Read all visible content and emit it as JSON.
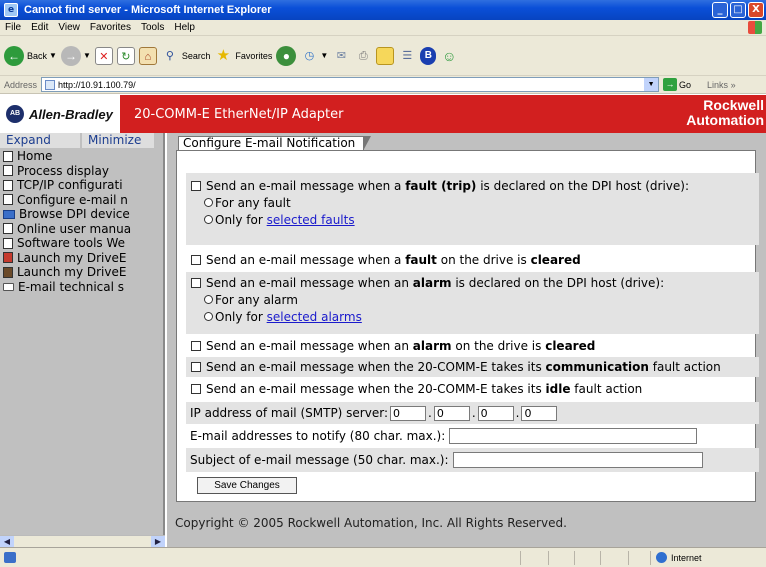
{
  "window": {
    "title": "Cannot find server - Microsoft Internet Explorer",
    "buttons": [
      "_",
      "□",
      "X"
    ]
  },
  "menu": [
    "File",
    "Edit",
    "View",
    "Favorites",
    "Tools",
    "Help"
  ],
  "toolbar": {
    "back": "Back",
    "search": "Search",
    "favorites": "Favorites"
  },
  "address": {
    "label": "Address",
    "url": "http://10.91.100.79/",
    "go": "Go",
    "links": "Links"
  },
  "brand": {
    "logo": "AB",
    "company": "Allen-Bradley",
    "product": "20-COMM-E EtherNet/IP Adapter",
    "rockwell_line1": "Rockwell",
    "rockwell_line2": "Automation"
  },
  "nav": {
    "expand": "Expand",
    "minimize": "Minimize",
    "items": [
      "Home",
      "Process display",
      "TCP/IP configurati",
      "Configure e-mail n",
      "Browse DPI device",
      "Online user manua",
      "Software tools We",
      "Launch my DriveE",
      "Launch my DriveE",
      "E-mail technical s"
    ]
  },
  "main": {
    "tab": "Configure E-mail Notification",
    "fault": {
      "pre": "Send an e-mail message when a ",
      "bold": "fault (trip)",
      "post": " is declared on the DPI host (drive):",
      "any": "For any fault",
      "only_pre": "Only for ",
      "only_link": "selected faults"
    },
    "fault_cleared": {
      "pre": "Send an e-mail message when a ",
      "bold1": "fault",
      "mid": " on the drive is ",
      "bold2": "cleared"
    },
    "alarm": {
      "pre": "Send an e-mail message when an ",
      "bold": "alarm",
      "post": " is declared on the DPI host (drive):",
      "any": "For any alarm",
      "only_pre": "Only for ",
      "only_link": "selected alarms"
    },
    "alarm_cleared": {
      "pre": "Send an e-mail message when an ",
      "bold1": "alarm",
      "mid": " on the drive is ",
      "bold2": "cleared"
    },
    "comm": {
      "pre": "Send an e-mail message when the 20-COMM-E takes its ",
      "bold": "communication",
      "post": " fault action"
    },
    "idle": {
      "pre": "Send an e-mail message when the 20-COMM-E takes its ",
      "bold": "idle",
      "post": " fault action"
    },
    "smtp": {
      "label": "IP address of mail (SMTP) server:",
      "octets": [
        "0",
        "0",
        "0",
        "0"
      ],
      "sep": "."
    },
    "addresses": {
      "label": "E-mail addresses to notify (80 char. max.):",
      "value": ""
    },
    "subject": {
      "label": "Subject of e-mail message (50 char. max.):",
      "value": ""
    },
    "save": "Save Changes",
    "copyright": "Copyright © 2005 Rockwell Automation, Inc. All Rights Reserved."
  },
  "status": {
    "zone": "Internet"
  }
}
